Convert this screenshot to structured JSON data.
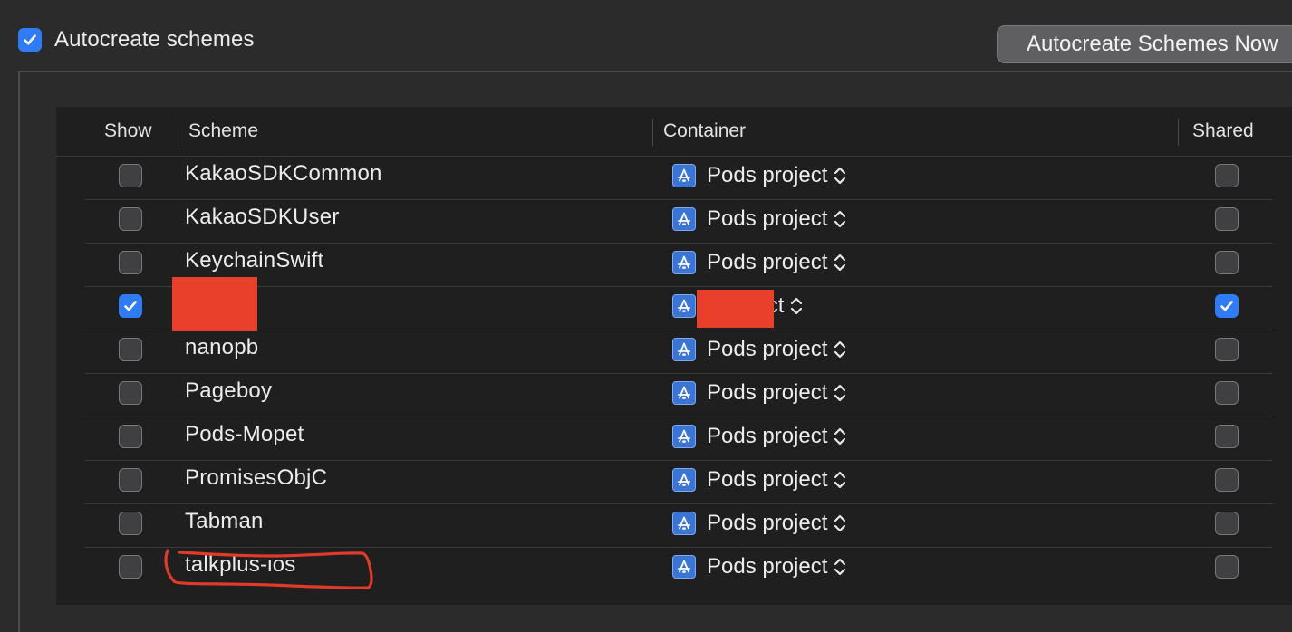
{
  "settings": {
    "autocreate_label": "Autocreate schemes",
    "autocreate_checked": true,
    "autocreate_now_button": "Autocreate Schemes Now"
  },
  "table": {
    "columns": {
      "show": "Show",
      "scheme": "Scheme",
      "container": "Container",
      "shared": "Shared"
    },
    "rows": [
      {
        "show": false,
        "scheme": "KakaoSDKCommon",
        "container": "Pods project",
        "shared": false
      },
      {
        "show": false,
        "scheme": "KakaoSDKUser",
        "container": "Pods project",
        "shared": false
      },
      {
        "show": false,
        "scheme": "KeychainSwift",
        "container": "Pods project",
        "shared": false
      },
      {
        "show": true,
        "scheme": "",
        "container": ": project",
        "shared": true,
        "redacted": true
      },
      {
        "show": false,
        "scheme": "nanopb",
        "container": "Pods project",
        "shared": false
      },
      {
        "show": false,
        "scheme": "Pageboy",
        "container": "Pods project",
        "shared": false
      },
      {
        "show": false,
        "scheme": "Pods-Mopet",
        "container": "Pods project",
        "shared": false
      },
      {
        "show": false,
        "scheme": "PromisesObjC",
        "container": "Pods project",
        "shared": false
      },
      {
        "show": false,
        "scheme": "Tabman",
        "container": "Pods project",
        "shared": false
      },
      {
        "show": false,
        "scheme": "talkplus-ios",
        "container": "Pods project",
        "shared": false
      }
    ]
  },
  "colors": {
    "accent": "#2f7cf6",
    "redaction": "#e8402a",
    "annotation": "#e23a2a"
  },
  "icons": {
    "checkbox_checked": "checkmark-icon",
    "project": "xcode-project-icon",
    "stepper": "up-down-chevron-icon"
  }
}
